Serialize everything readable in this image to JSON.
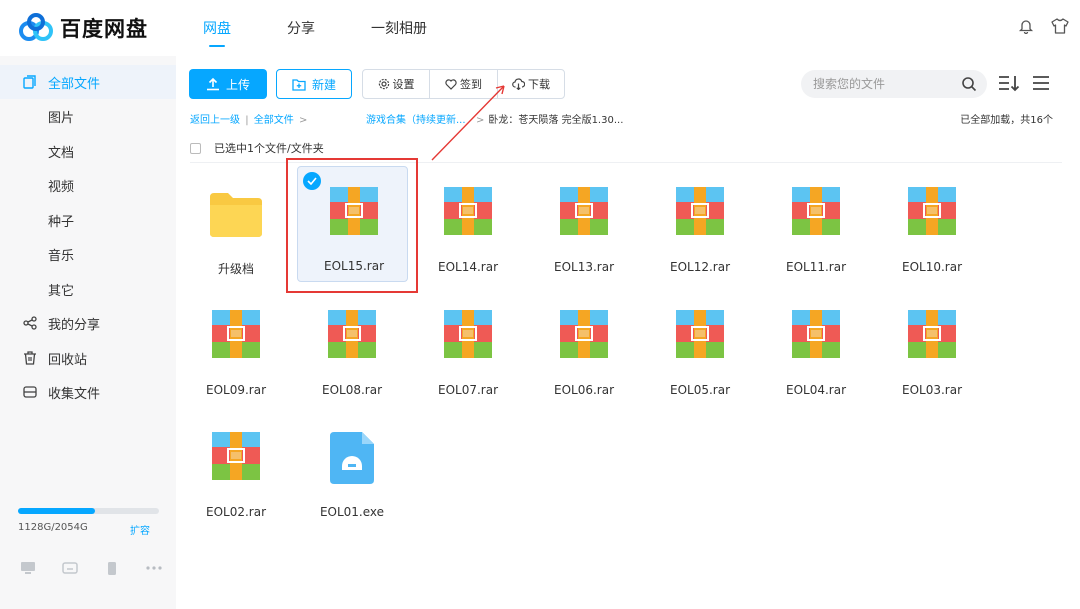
{
  "app": {
    "logo_text": "百度网盘"
  },
  "nav": {
    "items": [
      {
        "label": "网盘",
        "active": true
      },
      {
        "label": "分享",
        "active": false
      },
      {
        "label": "一刻相册",
        "active": false
      }
    ]
  },
  "top_icons": [
    "bell-icon",
    "tshirt-icon"
  ],
  "sidebar": {
    "items": [
      {
        "label": "全部文件",
        "icon": "files-icon",
        "active": true,
        "sub": false
      },
      {
        "label": "图片",
        "sub": true
      },
      {
        "label": "文档",
        "sub": true
      },
      {
        "label": "视频",
        "sub": true
      },
      {
        "label": "种子",
        "sub": true
      },
      {
        "label": "音乐",
        "sub": true
      },
      {
        "label": "其它",
        "sub": true
      },
      {
        "label": "我的分享",
        "icon": "share-icon",
        "sub": false
      },
      {
        "label": "回收站",
        "icon": "trash-icon",
        "sub": false
      },
      {
        "label": "收集文件",
        "icon": "inbox-icon",
        "sub": false
      }
    ],
    "storage": {
      "used_text": "1128G/2054G",
      "used_fraction": 0.549,
      "expand_label": "扩容"
    },
    "bottom_icons": [
      "monitor-icon",
      "cloud-device-icon",
      "phone-icon",
      "more-icon"
    ]
  },
  "toolbar": {
    "upload_label": "上传",
    "new_label": "新建",
    "settings_label": "设置",
    "signin_label": "签到",
    "download_label": "下载"
  },
  "search": {
    "placeholder": "搜索您的文件"
  },
  "breadcrumb": {
    "back": "返回上一级",
    "root": "全部文件",
    "sep": ">",
    "middle": "游戏合集（持续更新...",
    "current": "卧龙：苍天陨落 完全版1.30..."
  },
  "status": {
    "loaded": "已全部加载，共16个",
    "selection": "已选中1个文件/文件夹"
  },
  "files": [
    {
      "name": "升级档",
      "type": "folder",
      "selected": false
    },
    {
      "name": "EOL15.rar",
      "type": "rar",
      "selected": true
    },
    {
      "name": "EOL14.rar",
      "type": "rar",
      "selected": false
    },
    {
      "name": "EOL13.rar",
      "type": "rar",
      "selected": false
    },
    {
      "name": "EOL12.rar",
      "type": "rar",
      "selected": false
    },
    {
      "name": "EOL11.rar",
      "type": "rar",
      "selected": false
    },
    {
      "name": "EOL10.rar",
      "type": "rar",
      "selected": false
    },
    {
      "name": "EOL09.rar",
      "type": "rar",
      "selected": false
    },
    {
      "name": "EOL08.rar",
      "type": "rar",
      "selected": false
    },
    {
      "name": "EOL07.rar",
      "type": "rar",
      "selected": false
    },
    {
      "name": "EOL06.rar",
      "type": "rar",
      "selected": false
    },
    {
      "name": "EOL05.rar",
      "type": "rar",
      "selected": false
    },
    {
      "name": "EOL04.rar",
      "type": "rar",
      "selected": false
    },
    {
      "name": "EOL03.rar",
      "type": "rar",
      "selected": false
    },
    {
      "name": "EOL02.rar",
      "type": "rar",
      "selected": false
    },
    {
      "name": "EOL01.exe",
      "type": "exe",
      "selected": false
    }
  ],
  "colors": {
    "accent": "#06a7ff",
    "annotation": "#e53935"
  }
}
